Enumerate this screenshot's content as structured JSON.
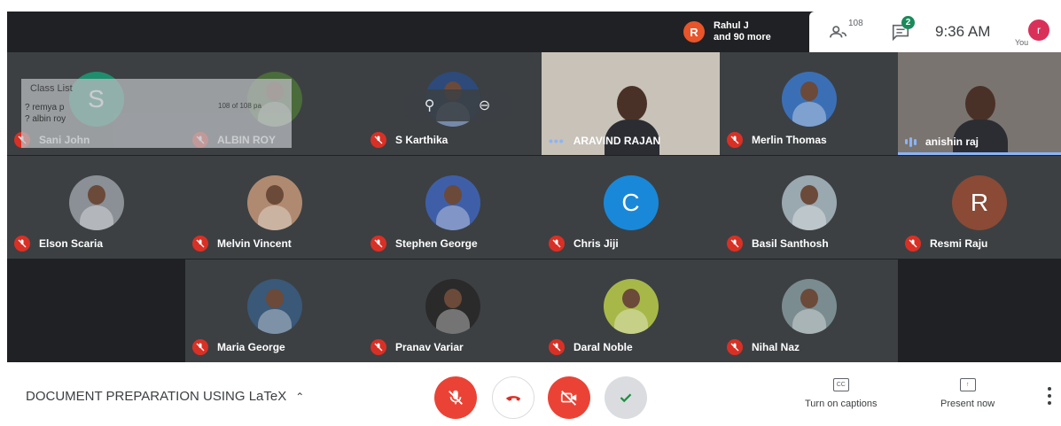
{
  "topbar": {
    "presenter": {
      "initial": "R",
      "line1": "Rahul J",
      "line2": "and 90 more"
    },
    "people_count": "108",
    "chat_badge": "2",
    "time": "9:36 AM",
    "self": {
      "initial": "r",
      "label": "You"
    }
  },
  "overlay": {
    "class_list_title": "Class List",
    "class_list_lines": [
      "? remya p",
      "? albin roy"
    ],
    "class_list_count": "108 of 108 pa"
  },
  "participants": [
    {
      "name": "Sani John",
      "initial": "S",
      "avatar_color": "#1e8e6e",
      "status": "muted"
    },
    {
      "name": "ALBIN ROY",
      "initial": "",
      "avatar_color": "#4a6b3a",
      "status": "muted"
    },
    {
      "name": "S Karthika",
      "initial": "",
      "avatar_color": "#2d4a7a",
      "status": "muted"
    },
    {
      "name": "ARAVIND RAJAN",
      "initial": "",
      "avatar_color": "#c8c2b8",
      "status": "active"
    },
    {
      "name": "Merlin Thomas",
      "initial": "",
      "avatar_color": "#3b6fb5",
      "status": "muted"
    },
    {
      "name": "anishin raj",
      "initial": "",
      "avatar_color": "#7a7470",
      "status": "speaking"
    },
    {
      "name": "Elson Scaria",
      "initial": "",
      "avatar_color": "#8a9095",
      "status": "muted"
    },
    {
      "name": "Melvin Vincent",
      "initial": "",
      "avatar_color": "#b08a70",
      "status": "muted"
    },
    {
      "name": "Stephen George",
      "initial": "",
      "avatar_color": "#3e5fa8",
      "status": "muted"
    },
    {
      "name": "Chris Jiji",
      "initial": "C",
      "avatar_color": "#1a88d8",
      "status": "muted"
    },
    {
      "name": "Basil Santhosh",
      "initial": "",
      "avatar_color": "#9aa8b0",
      "status": "muted"
    },
    {
      "name": "Resmi Raju",
      "initial": "R",
      "avatar_color": "#8a4a35",
      "status": "muted"
    },
    {
      "name": "Maria George",
      "initial": "",
      "avatar_color": "#3a5878",
      "status": "muted"
    },
    {
      "name": "Pranav Variar",
      "initial": "",
      "avatar_color": "#2a2a2a",
      "status": "muted"
    },
    {
      "name": "Daral Noble",
      "initial": "",
      "avatar_color": "#a8b848",
      "status": "muted"
    },
    {
      "name": "Nihal Naz",
      "initial": "",
      "avatar_color": "#7a8c90",
      "status": "muted"
    }
  ],
  "bottombar": {
    "meeting_title": "DOCUMENT PREPARATION USING LaTeX",
    "captions_label": "Turn on captions",
    "captions_icon_text": "CC",
    "present_label": "Present now"
  },
  "icons": {
    "mic": "mic-off-icon",
    "hangup": "call-end-icon",
    "camera": "videocam-off-icon",
    "check": "check-icon",
    "people": "people-icon",
    "chat": "chat-icon",
    "pin": "pin-icon",
    "remove": "remove-icon",
    "more": "more-vert-icon"
  },
  "colors": {
    "danger": "#ea4335",
    "background": "#202124",
    "tile": "#3c4043"
  }
}
